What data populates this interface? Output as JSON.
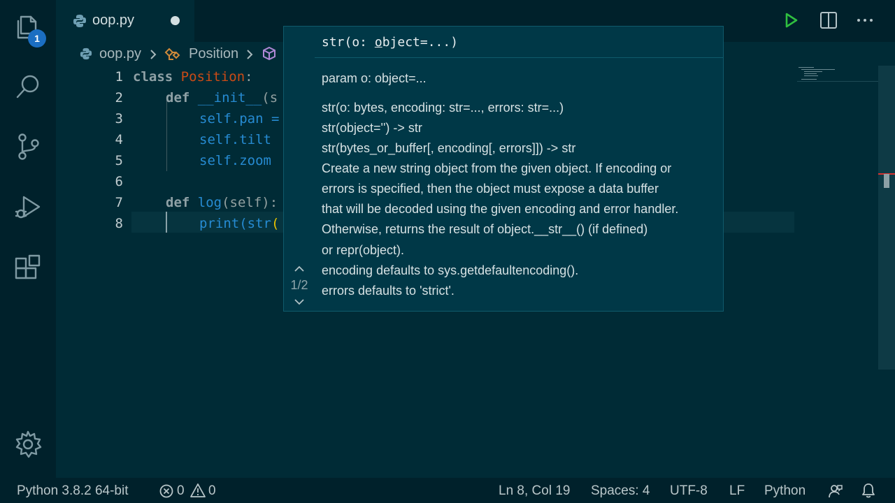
{
  "activity_bar": {
    "explorer_badge": "1",
    "items": [
      "files-icon",
      "search-icon",
      "source-control-icon",
      "run-debug-icon",
      "extensions-icon",
      "settings-gear-icon"
    ]
  },
  "tab": {
    "label": "oop.py",
    "unsaved": true
  },
  "breadcrumb": {
    "file": "oop.py",
    "symbol": "Position"
  },
  "editor": {
    "line_numbers": [
      "1",
      "2",
      "3",
      "4",
      "5",
      "6",
      "7",
      "8"
    ],
    "lines": [
      {
        "kw": "class",
        "name": "Position",
        "rest": ":"
      },
      {
        "kw": "def",
        "name": "__init__",
        "rest": "(s"
      },
      {
        "text": "self.pan ="
      },
      {
        "text": "self.tilt"
      },
      {
        "text": "self.zoom"
      },
      {
        "text": ""
      },
      {
        "kw": "def",
        "name": "log",
        "rest": "(self):"
      },
      {
        "pre": "print(",
        "name": "str",
        "rest": "("
      }
    ]
  },
  "hover": {
    "signature_prefix": "str(o: ",
    "signature_underline": "o",
    "signature_suffix": "bject=...)",
    "param": "param o: object=...",
    "lines": [
      "str(o: bytes, encoding: str=..., errors: str=...)",
      "str(object='') -> str",
      "str(bytes_or_buffer[, encoding[, errors]]) -> str",
      "Create a new string object from the given object. If encoding or",
      "errors is specified, then the object must expose a data buffer",
      "that will be decoded using the given encoding and error handler.",
      "Otherwise, returns the result of object.__str__() (if defined)",
      "or repr(object).",
      "encoding defaults to sys.getdefaultencoding().",
      "errors defaults to 'strict'."
    ],
    "overload_counter": "1/2"
  },
  "status_bar": {
    "interpreter": "Python 3.8.2 64-bit",
    "errors": "0",
    "warnings": "0",
    "position": "Ln 8, Col 19",
    "indentation": "Spaces: 4",
    "encoding": "UTF-8",
    "eol": "LF",
    "language": "Python"
  },
  "colors": {
    "editor_bg": "#002b36",
    "sidebar_bg": "#00212b",
    "keyword": "#8fa1a6",
    "class_name": "#cb4b16",
    "function": "#268bd2",
    "badge": "#1b6ec2",
    "run_button": "#2fbf40"
  }
}
